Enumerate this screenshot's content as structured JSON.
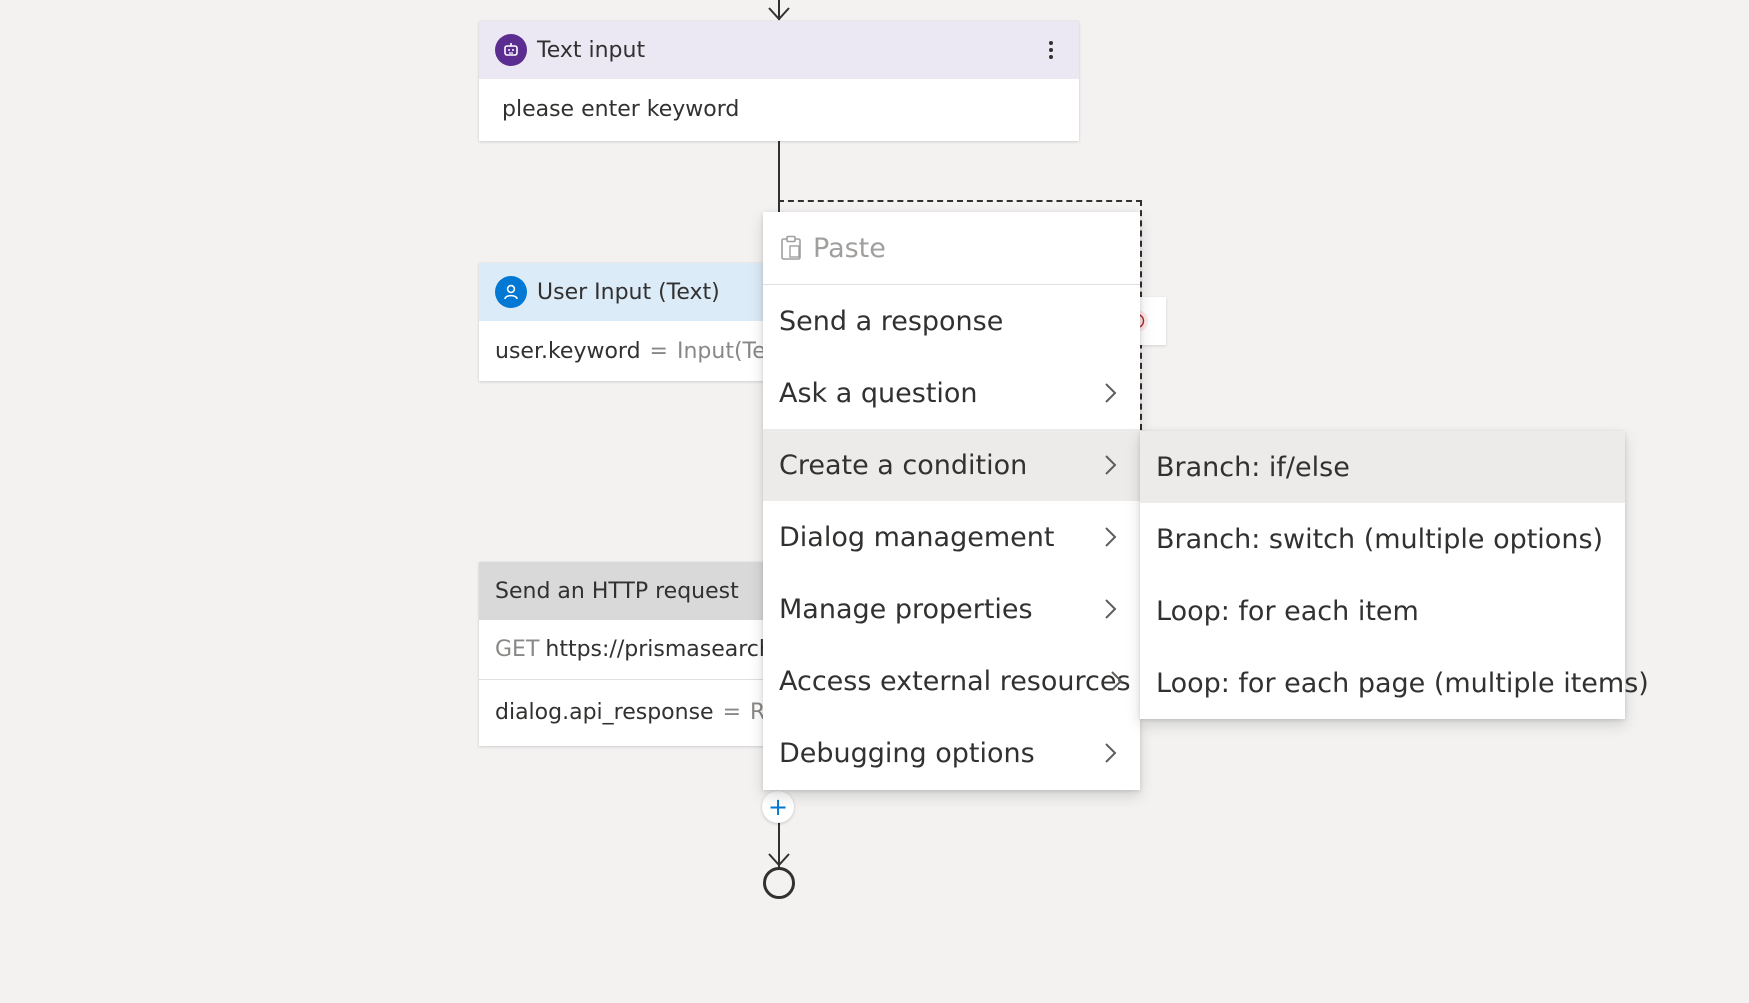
{
  "text_input_node": {
    "title": "Text input",
    "body": "please enter keyword"
  },
  "user_input_node": {
    "title": "User Input (Text)",
    "property": "user.keyword",
    "equals": "=",
    "value": "Input(Text"
  },
  "http_node": {
    "title": "Send an HTTP request",
    "method": "GET",
    "url": "https://prismasearch-",
    "result_property": "dialog.api_response",
    "equals": "=",
    "result_value": "Res"
  },
  "context_menu": {
    "paste_label": "Paste",
    "items": [
      {
        "label": "Send a response",
        "has_submenu": false
      },
      {
        "label": "Ask a question",
        "has_submenu": true
      },
      {
        "label": "Create a condition",
        "has_submenu": true,
        "selected": true
      },
      {
        "label": "Dialog management",
        "has_submenu": true
      },
      {
        "label": "Manage properties",
        "has_submenu": true
      },
      {
        "label": "Access external resources",
        "has_submenu": true
      },
      {
        "label": "Debugging options",
        "has_submenu": true
      }
    ]
  },
  "submenu": {
    "items": [
      {
        "label": "Branch: if/else",
        "selected": true
      },
      {
        "label": "Branch: switch (multiple options)"
      },
      {
        "label": "Loop: for each item"
      },
      {
        "label": "Loop: for each page (multiple items)"
      }
    ]
  },
  "add_button": {
    "symbol": "+"
  },
  "colors": {
    "canvas_bg": "#f3f2f1",
    "text_input_header": "#ebe8f3",
    "text_input_icon": "#5c2d91",
    "user_input_header": "#dcebf8",
    "user_input_icon": "#0078d4",
    "http_header": "#d9d9d9",
    "menu_selected": "#edebe9",
    "accent": "#0078d4"
  },
  "icons": {
    "text_input_icon": "bot-icon",
    "user_input_icon": "person-icon",
    "paste_icon": "clipboard-icon",
    "more_icon": "more-vertical-icon",
    "chevron": "chevron-right-icon",
    "error_icon": "error-circle-icon",
    "end_icon": "end-circle-icon"
  }
}
